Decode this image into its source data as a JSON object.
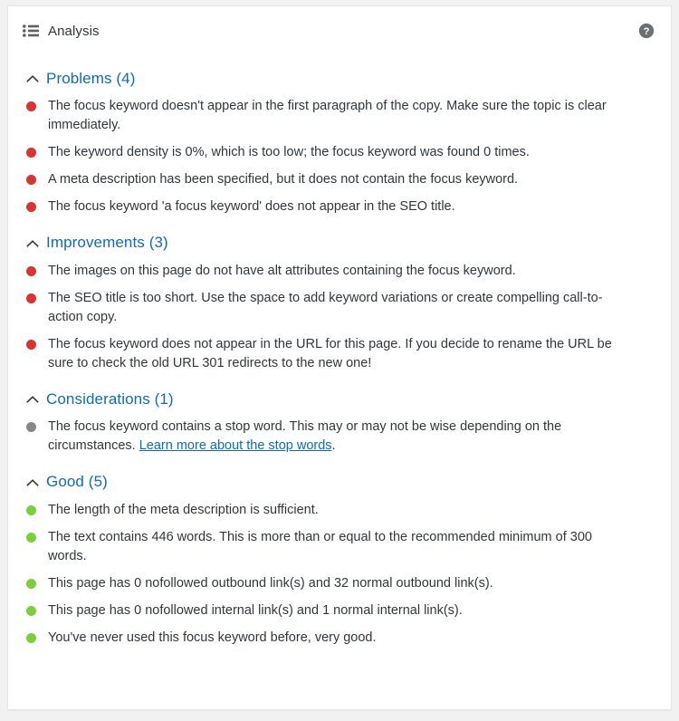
{
  "header": {
    "title": "Analysis",
    "list_icon": "list-icon",
    "help_icon": "help-circle-icon"
  },
  "colors": {
    "heading": "#0f6cb0",
    "bad": "#dc3232",
    "good": "#7ad03a",
    "neutral": "#888888",
    "text": "#32373c",
    "card_border": "#e2e4e7",
    "page_background": "#f1f1f1"
  },
  "sections": [
    {
      "label": "Problems (4)",
      "name": "problems",
      "collapse_icon": "chevron-up-icon",
      "items": [
        {
          "status": "red",
          "text": "The focus keyword doesn't appear in the first paragraph of the copy. Make sure the topic is clear immediately."
        },
        {
          "status": "red",
          "text": "The keyword density is 0%, which is too low; the focus keyword was found 0 times."
        },
        {
          "status": "red",
          "text": "A meta description has been specified, but it does not contain the focus keyword."
        },
        {
          "status": "red",
          "text": "The focus keyword 'a focus keyword' does not appear in the SEO title."
        }
      ]
    },
    {
      "label": "Improvements (3)",
      "name": "improvements",
      "collapse_icon": "chevron-up-icon",
      "items": [
        {
          "status": "red",
          "text": "The images on this page do not have alt attributes containing the focus keyword."
        },
        {
          "status": "red",
          "text": "The SEO title is too short. Use the space to add keyword variations or create compelling call-to-action copy."
        },
        {
          "status": "red",
          "text": "The focus keyword does not appear in the URL for this page. If you decide to rename the URL be sure to check the old URL 301 redirects to the new one!"
        }
      ]
    },
    {
      "label": "Considerations (1)",
      "name": "considerations",
      "collapse_icon": "chevron-up-icon",
      "items": [
        {
          "status": "gray",
          "text_before": "The focus keyword contains a stop word. This may or may not be wise depending on the circumstances. ",
          "link_text": "Learn more about the stop words",
          "text_after": "."
        }
      ]
    },
    {
      "label": "Good (5)",
      "name": "good",
      "collapse_icon": "chevron-up-icon",
      "items": [
        {
          "status": "green",
          "text": "The length of the meta description is sufficient."
        },
        {
          "status": "green",
          "text": "The text contains 446 words. This is more than or equal to the recommended minimum of 300 words."
        },
        {
          "status": "green",
          "text": "This page has 0 nofollowed outbound link(s) and 32 normal outbound link(s)."
        },
        {
          "status": "green",
          "text": "This page has 0 nofollowed internal link(s) and 1 normal internal link(s)."
        },
        {
          "status": "green",
          "text": "You've never used this focus keyword before, very good."
        }
      ]
    }
  ]
}
